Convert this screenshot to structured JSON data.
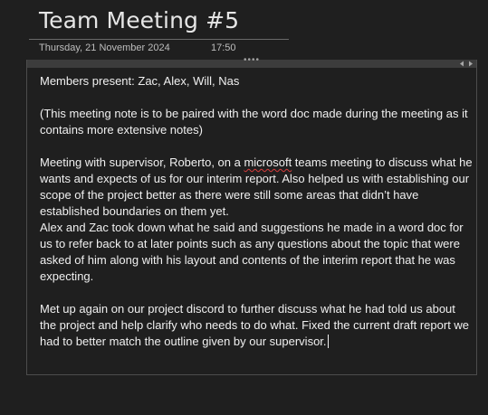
{
  "page": {
    "title": "Team Meeting #5",
    "date": "Thursday, 21 November 2024",
    "time": "17:50"
  },
  "container": {
    "drag_handle_icon": "drag-dots-icon",
    "resize_icon": "horizontal-resize-arrows-icon",
    "handle_glyph": "••••"
  },
  "note": {
    "members": "Members present: Zac, Alex, Will, Nas",
    "pairing_note": "(This meeting note is to be paired with the word doc made during the meeting as it contains more extensive notes)",
    "para1_pre": "Meeting with supervisor, Roberto, on a ",
    "para1_misspelled": "microsoft",
    "para1_post": " teams meeting to discuss what he wants and expects of us for our interim report. Also helped us with establishing our scope of the project better as there were still some areas that didn’t have established boundaries on them yet.",
    "para2": "Alex and Zac took down what he said and suggestions he made in a word doc for us to refer back to at later points such as any questions about the topic that were asked of him along with his layout and contents of the interim report that he was expecting.",
    "para3": "Met up again on our project discord to further discuss what he had told us about the project and help clarify who needs to do what. Fixed the current draft report we had to better match the outline given by our supervisor."
  },
  "colors": {
    "background": "#1f1f1f",
    "text": "#f0f0f0",
    "spellcheck_underline": "#d83a3a",
    "container_border": "#4c4c4c"
  }
}
